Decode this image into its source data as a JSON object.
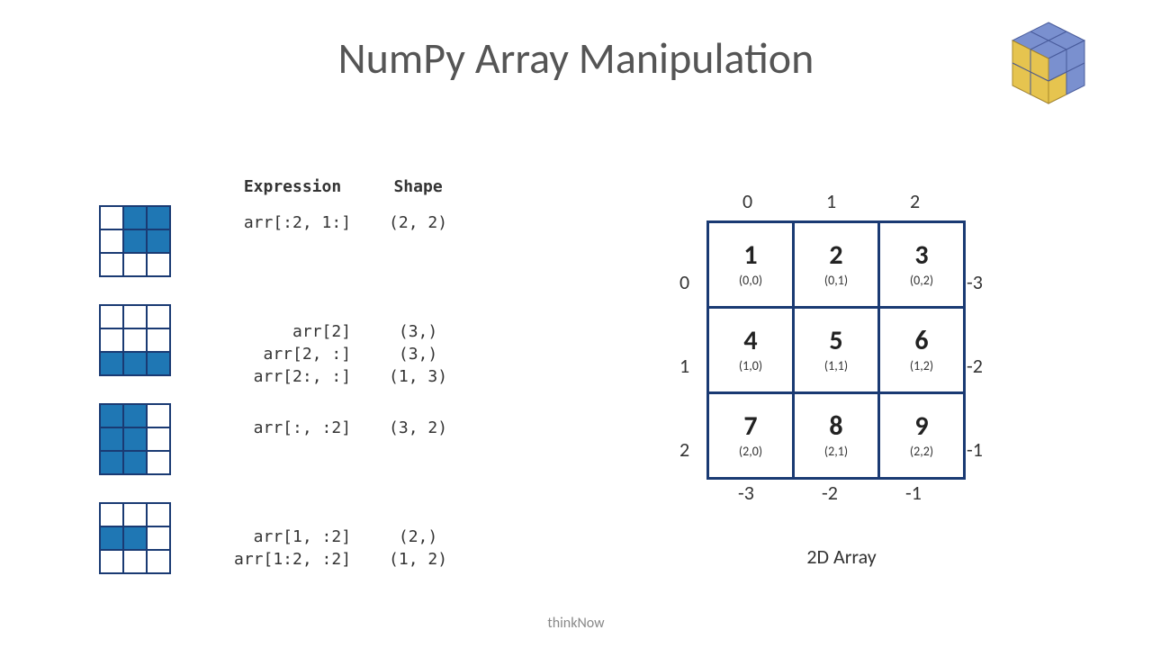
{
  "title": "NumPy Array Manipulation",
  "footer": "thinkNow",
  "columns": {
    "expr": "Expression",
    "shape": "Shape"
  },
  "slices": [
    {
      "fill": [
        [
          0,
          1,
          1
        ],
        [
          0,
          1,
          1
        ],
        [
          0,
          0,
          0
        ]
      ],
      "rows": [
        {
          "expr": "arr[:2, 1:]",
          "shape": "(2, 2)"
        }
      ]
    },
    {
      "fill": [
        [
          0,
          0,
          0
        ],
        [
          0,
          0,
          0
        ],
        [
          1,
          1,
          1
        ]
      ],
      "rows": [
        {
          "expr": "arr[2]",
          "shape": "(3,)"
        },
        {
          "expr": "arr[2, :]",
          "shape": "(3,)"
        },
        {
          "expr": "arr[2:, :]",
          "shape": "(1, 3)"
        }
      ]
    },
    {
      "fill": [
        [
          1,
          1,
          0
        ],
        [
          1,
          1,
          0
        ],
        [
          1,
          1,
          0
        ]
      ],
      "rows": [
        {
          "expr": "arr[:, :2]",
          "shape": "(3, 2)"
        }
      ]
    },
    {
      "fill": [
        [
          0,
          0,
          0
        ],
        [
          1,
          1,
          0
        ],
        [
          0,
          0,
          0
        ]
      ],
      "rows": [
        {
          "expr": "arr[1, :2]",
          "shape": "(2,)"
        },
        {
          "expr": "arr[1:2, :2]",
          "shape": "(1, 2)"
        }
      ]
    }
  ],
  "array2d": {
    "caption": "2D Array",
    "top": [
      "0",
      "1",
      "2"
    ],
    "left": [
      "0",
      "1",
      "2"
    ],
    "right": [
      "-3",
      "-2",
      "-1"
    ],
    "bottom": [
      "-3",
      "-2",
      "-1"
    ],
    "cells": [
      [
        {
          "v": "1",
          "c": "(0,0)"
        },
        {
          "v": "2",
          "c": "(0,1)"
        },
        {
          "v": "3",
          "c": "(0,2)"
        }
      ],
      [
        {
          "v": "4",
          "c": "(1,0)"
        },
        {
          "v": "5",
          "c": "(1,1)"
        },
        {
          "v": "6",
          "c": "(1,2)"
        }
      ],
      [
        {
          "v": "7",
          "c": "(2,0)"
        },
        {
          "v": "8",
          "c": "(2,1)"
        },
        {
          "v": "9",
          "c": "(2,2)"
        }
      ]
    ]
  }
}
